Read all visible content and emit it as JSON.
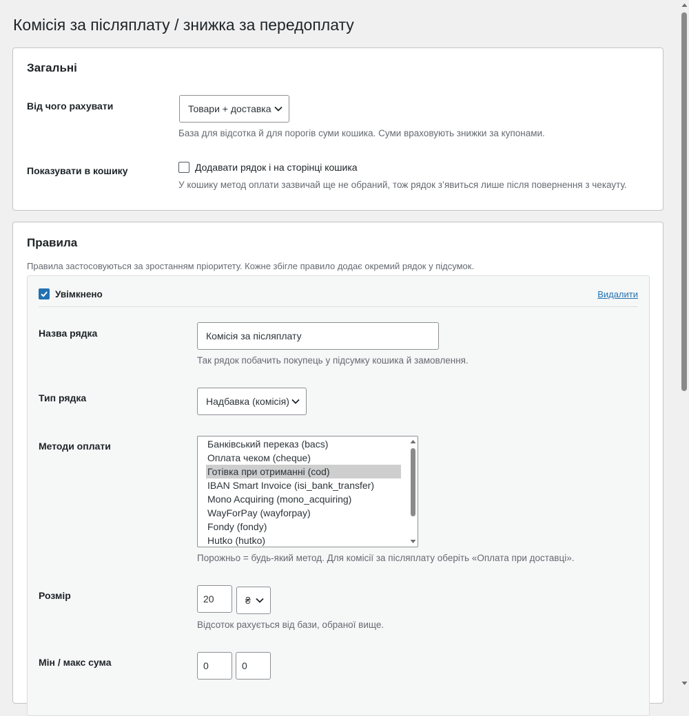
{
  "page": {
    "title": "Комісія за післяплату / знижка за передоплату"
  },
  "general": {
    "heading": "Загальні",
    "base": {
      "label": "Від чого рахувати",
      "value": "Товари + доставка",
      "desc": "База для відсотка й для порогів суми кошика. Суми враховують знижки за купонами."
    },
    "cart": {
      "label": "Показувати в кошику",
      "checkbox_label": "Додавати рядок і на сторінці кошика",
      "checked": false,
      "desc": "У кошику метод оплати зазвичай ще не обраний, тож рядок з’явиться лише після повернення з чекауту."
    }
  },
  "rules": {
    "heading": "Правила",
    "intro": "Правила застосовуються за зростанням пріоритету. Кожне збігле правило додає окремий рядок у підсумок.",
    "rule": {
      "enabled_label": "Увімкнено",
      "enabled": true,
      "delete_label": "Видалити",
      "name": {
        "label": "Назва рядка",
        "value": "Комісія за післяплату",
        "desc": "Так рядок побачить покупець у підсумку кошика й замовлення."
      },
      "type": {
        "label": "Тип рядка",
        "value": "Надбавка (комісія)"
      },
      "methods": {
        "label": "Методи оплати",
        "options": [
          "Банківський переказ (bacs)",
          "Оплата чеком (cheque)",
          "Готівка при отриманні (cod)",
          "IBAN Smart Invoice (isi_bank_transfer)",
          "Mono Acquiring (mono_acquiring)",
          "WayForPay (wayforpay)",
          "Fondy (fondy)",
          "Hutko (hutko)"
        ],
        "selected": "Готівка при отриманні (cod)",
        "desc": "Порожньо = будь-який метод. Для комісії за післяплату оберіть «Оплата при доставці»."
      },
      "size": {
        "label": "Розмір",
        "value": "20",
        "unit": "₴",
        "desc": "Відсоток рахується від бази, обраної вище."
      },
      "minmax": {
        "label": "Мін / макс сума",
        "min": "0",
        "max": "0"
      }
    }
  },
  "colors": {
    "accent": "#2271b1",
    "selected_option": "#cecece"
  }
}
